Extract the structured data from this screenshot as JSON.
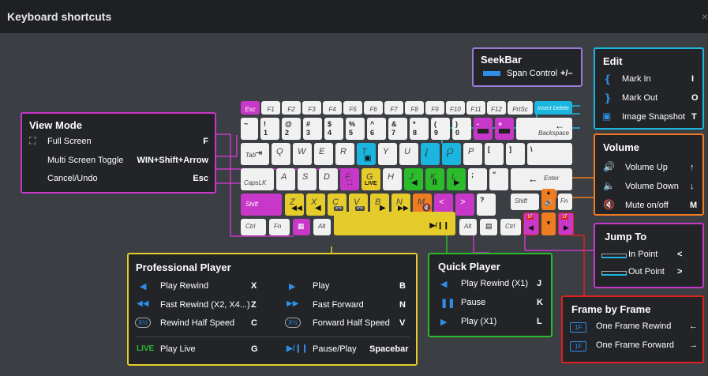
{
  "window": {
    "title": "Keyboard shortcuts",
    "close_glyph": "×"
  },
  "colors": {
    "magenta": "#c838c8",
    "cyan": "#1ab6e0",
    "yellow": "#e6cc2a",
    "green": "#2bbb2b",
    "orange": "#f07c22",
    "red": "#e02020",
    "purple": "#9a7cd8",
    "blue": "#2e8fe8"
  },
  "keys": {
    "esc": "Esc",
    "f1": "F1",
    "f2": "F2",
    "f3": "F3",
    "f4": "F4",
    "f5": "F5",
    "f6": "F6",
    "f7": "F7",
    "f8": "F8",
    "f9": "F9",
    "f10": "F10",
    "f11": "F11",
    "f12": "F12",
    "prtsc": "PrtSc",
    "insert_delete": "Insert Delete",
    "tilde": "~",
    "n1": "1",
    "n1s": "!",
    "n2": "2",
    "n2s": "@",
    "n3": "3",
    "n3s": "#",
    "n4": "4",
    "n4s": "$",
    "n5": "5",
    "n5s": "%",
    "n6": "6",
    "n6s": "^",
    "n7": "7",
    "n7s": "&",
    "n8": "8",
    "n8s": "*",
    "n9": "9",
    "n9s": "(",
    "n0": "0",
    "n0s": ")",
    "minus": "-",
    "plus": "+",
    "backspace": "Backspace",
    "tab": "Tab",
    "q": "Q",
    "w": "W",
    "e": "E",
    "r": "R",
    "t": "T",
    "y": "Y",
    "u": "U",
    "i": "I",
    "o": "O",
    "p": "P",
    "lbr": "[",
    "rbr": "]",
    "bslash": "\\",
    "capslk": "CapsLK",
    "a": "A",
    "s": "S",
    "d": "D",
    "f": "F",
    "g": "G",
    "g_live": "LIVE",
    "h": "H",
    "j": "J",
    "k": "K",
    "l": "L",
    "semi": ";",
    "quote": "\"",
    "enter": "Enter",
    "shift": "Shift",
    "z": "Z",
    "x": "X",
    "c": "C",
    "v": "V",
    "b": "B",
    "n": "N",
    "m": "M",
    "lt": "<",
    "gt": ">",
    "qmark": "?",
    "rshift": "Shift",
    "fn": "Fn",
    "ctrl": "Ctrl",
    "fn2": "Fn",
    "alt": "Alt",
    "space_icon": "▶/❙❙",
    "ralt": "Alt",
    "rctrl": "Ctrl",
    "one_f": "1F",
    "x_half": "x½"
  },
  "seekbar": {
    "title": "SeekBar",
    "label": "Span Control",
    "key": "+/–"
  },
  "edit": {
    "title": "Edit",
    "rows": [
      {
        "label": "Mark In",
        "key": "I"
      },
      {
        "label": "Mark Out",
        "key": "O"
      },
      {
        "label": "Image Snapshot",
        "key": "T"
      }
    ]
  },
  "view_mode": {
    "title": "View Mode",
    "rows": [
      {
        "label": "Full Screen",
        "key": "F"
      },
      {
        "label": "Multi Screen Toggle",
        "key": "WIN+Shift+Arrow"
      },
      {
        "label": "Cancel/Undo",
        "key": "Esc"
      }
    ]
  },
  "volume": {
    "title": "Volume",
    "rows": [
      {
        "label": "Volume Up",
        "key": "↑"
      },
      {
        "label": "Volume Down",
        "key": "↓"
      },
      {
        "label": "Mute on/off",
        "key": "M"
      }
    ]
  },
  "jump_to": {
    "title": "Jump To",
    "rows": [
      {
        "label": "In Point",
        "key": "<"
      },
      {
        "label": "Out Point",
        "key": ">"
      }
    ]
  },
  "frame_by_frame": {
    "title": "Frame by Frame",
    "rows": [
      {
        "icon": "1F",
        "label": "One Frame Rewind",
        "key": "←"
      },
      {
        "icon": "1F",
        "label": "One Frame Forward",
        "key": "→"
      }
    ]
  },
  "quick_player": {
    "title": "Quick Player",
    "rows": [
      {
        "label": "Play Rewind (X1)",
        "key": "J"
      },
      {
        "label": "Pause",
        "key": "K"
      },
      {
        "label": "Play (X1)",
        "key": "L"
      }
    ]
  },
  "pro_player": {
    "title": "Professional Player",
    "left": [
      {
        "label": "Play Rewind",
        "key": "X"
      },
      {
        "label": "Fast Rewind (X2, X4...)",
        "key": "Z"
      },
      {
        "icon": "X½",
        "label": "Rewind Half Speed",
        "key": "C"
      }
    ],
    "right": [
      {
        "label": "Play",
        "key": "B"
      },
      {
        "label": "Fast Forward",
        "key": "N"
      },
      {
        "icon": "X½",
        "label": "Forward Half Speed",
        "key": "V"
      }
    ],
    "live": {
      "icon": "LIVE",
      "label": "Play Live",
      "key": "G"
    },
    "pause": {
      "icon": "▶/❙❙",
      "label": "Pause/Play",
      "key": "Spacebar"
    }
  }
}
